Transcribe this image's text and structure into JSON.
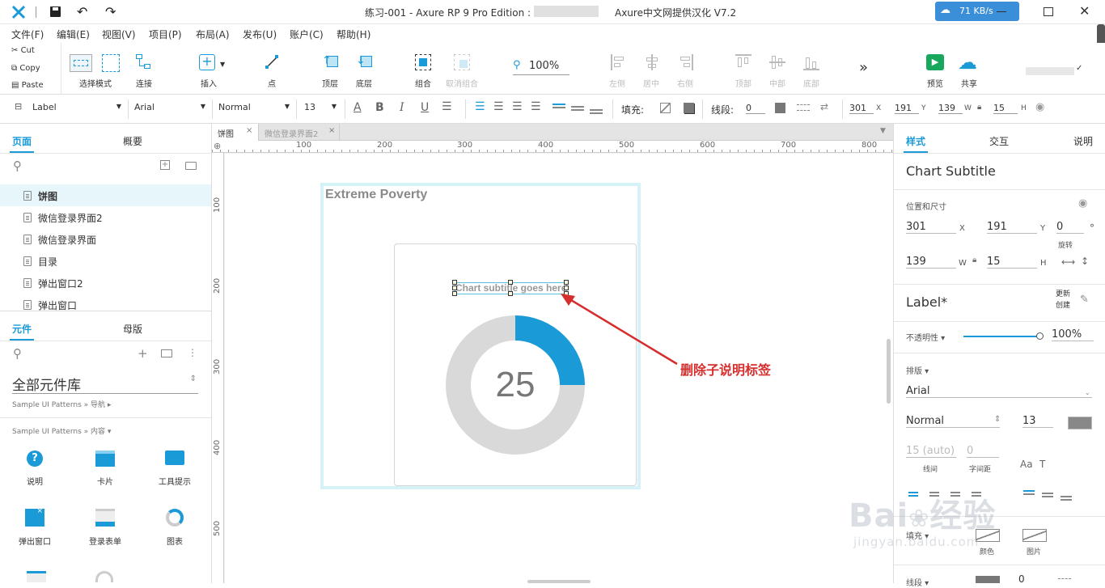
{
  "titlebar": {
    "title": "练习-001 - Axure RP 9 Pro Edition :",
    "subtitle": "Axure中文网提供汉化 V7.2",
    "speed": "71 KB/s"
  },
  "menubar": [
    "文件(F)",
    "编辑(E)",
    "视图(V)",
    "项目(P)",
    "布局(A)",
    "发布(U)",
    "账户(C)",
    "帮助(H)"
  ],
  "clipboard": {
    "cut": "Cut",
    "copy": "Copy",
    "paste": "Paste"
  },
  "toolbar": {
    "select_mode": "选择模式",
    "connect": "连接",
    "insert": "插入",
    "point": "点",
    "top_layer": "顶层",
    "bottom_layer": "底层",
    "group": "组合",
    "ungroup": "取消组合",
    "zoom": "100%",
    "align_left": "左侧",
    "align_center": "居中",
    "align_right": "右侧",
    "align_top": "顶部",
    "align_middle": "中部",
    "align_bottom": "底部",
    "more": "»",
    "preview": "预览",
    "share": "共享"
  },
  "formatbar": {
    "style": "Label",
    "font": "Arial",
    "weight": "Normal",
    "size": "13",
    "fill_label": "填充:",
    "stroke_label": "线段:",
    "stroke_value": "0",
    "x": "301",
    "x_lbl": "X",
    "y": "191",
    "y_lbl": "Y",
    "w": "139",
    "w_lbl": "W",
    "h": "15",
    "h_lbl": "H"
  },
  "left": {
    "pages_tab": "页面",
    "outline_tab": "概要",
    "pages": [
      "饼图",
      "微信登录界面2",
      "微信登录界面",
      "目录",
      "弹出窗口2",
      "弹出窗口"
    ],
    "widgets_tab": "元件",
    "masters_tab": "母版",
    "library": "全部元件库",
    "cat1": "Sample UI Patterns » 导航 ▸",
    "cat2": "Sample UI Patterns » 内容 ▾",
    "widgets": [
      "说明",
      "卡片",
      "工具提示",
      "弹出窗口",
      "登录表单",
      "图表"
    ]
  },
  "tabs": [
    "饼图",
    "微信登录界面2"
  ],
  "ruler": {
    "h": [
      "100",
      "200",
      "300",
      "400",
      "500",
      "600",
      "700",
      "800"
    ],
    "v": [
      "100",
      "200",
      "300",
      "400",
      "500"
    ]
  },
  "canvas": {
    "heading": "Extreme Poverty",
    "subtitle": "Chart subtitle goes here",
    "center_value": "25",
    "annotation": "删除子说明标签"
  },
  "chart_data": {
    "type": "pie",
    "title": "",
    "values": [
      25,
      75
    ],
    "colors": [
      "#1a9ad6",
      "#d9d9d9"
    ]
  },
  "right": {
    "style_tab": "样式",
    "interact_tab": "交互",
    "notes_tab": "说明",
    "widget_name": "Chart Subtitle",
    "pos_size": "位置和尺寸",
    "x": "301",
    "x_lbl": "X",
    "y": "191",
    "y_lbl": "Y",
    "rot": "0",
    "rot_unit": "°",
    "rot_lbl": "旋转",
    "w": "139",
    "w_lbl": "W",
    "h": "15",
    "h_lbl": "H",
    "style_name": "Label*",
    "update_create": "更新\n创建",
    "opacity_lbl": "不透明性 ▾",
    "opacity": "100%",
    "typography_lbl": "排版 ▾",
    "font": "Arial",
    "weight": "Normal",
    "size": "13",
    "line_height": "15 (auto)",
    "line_height_lbl": "线间",
    "char_spacing": "0",
    "char_spacing_lbl": "字间距",
    "fill_lbl": "填充 ▾",
    "fill_color_lbl": "颜色",
    "fill_image_lbl": "图片",
    "stroke_lbl": "线段 ▾",
    "stroke_val": "0"
  },
  "colors": {
    "accent": "#1a9ad6",
    "annotation": "#d62d2d",
    "selection": "#5bc0de"
  }
}
